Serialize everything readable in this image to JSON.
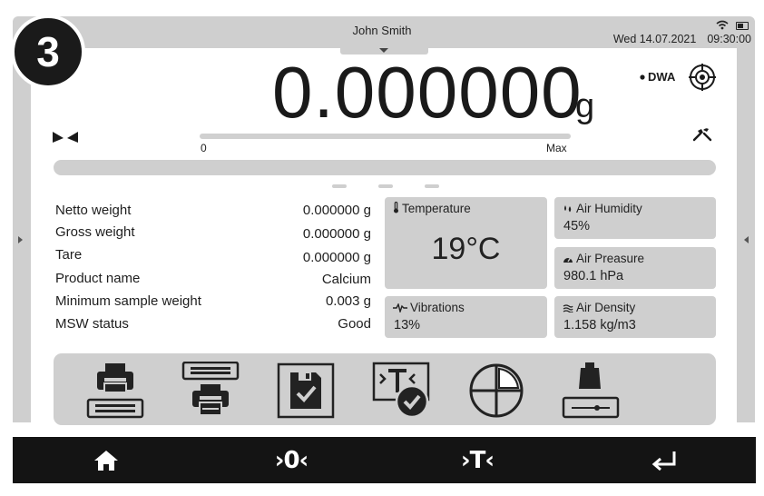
{
  "header": {
    "user_name": "John Smith",
    "date": "Wed 14.07.2021",
    "time": "09:30:00"
  },
  "step_badge": "3",
  "weighing": {
    "value": "0.000000",
    "unit": "g",
    "mode": "DWA",
    "range_min": "0",
    "range_max": "Max",
    "range_fill_fraction": 0.0
  },
  "info": [
    {
      "label": "Netto weight",
      "value": "0.000000 g"
    },
    {
      "label": "Gross weight",
      "value": "0.000000 g"
    },
    {
      "label": "Tare",
      "value": "0.000000 g"
    },
    {
      "label": "Product name",
      "value": "Calcium"
    },
    {
      "label": "Minimum sample weight",
      "value": "0.003 g"
    },
    {
      "label": "MSW status",
      "value": "Good"
    }
  ],
  "tiles": {
    "temperature": {
      "label": "Temperature",
      "value": "19°C"
    },
    "humidity": {
      "label": "Air Humidity",
      "value": "45%"
    },
    "pressure": {
      "label": "Air Preasure",
      "value": "980.1 hPa"
    },
    "vibrations": {
      "label": "Vibrations",
      "value": "13%"
    },
    "density": {
      "label": "Air Density",
      "value": "1.158 kg/m3"
    }
  },
  "toolbar_icons": [
    "print-header-icon",
    "print-footer-icon",
    "save-report-icon",
    "tare-confirm-icon",
    "pie-chart-icon",
    "weight-on-scale-icon"
  ],
  "bottom_nav": {
    "zero_label": "›0‹",
    "tare_label": "›T‹"
  },
  "colors": {
    "panel": "#cfcfcf",
    "bottom_bar": "#141414",
    "text": "#1e1e1e"
  }
}
